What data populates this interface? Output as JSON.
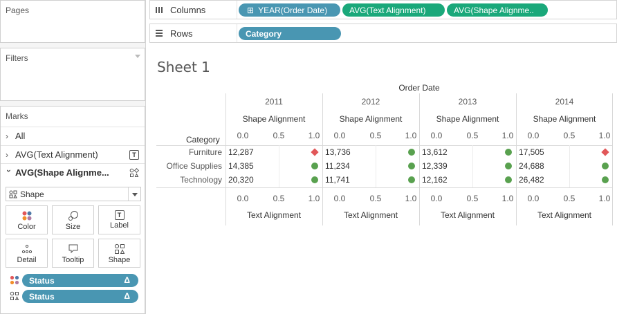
{
  "left_panel": {
    "pages_title": "Pages",
    "filters_title": "Filters",
    "marks_title": "Marks",
    "marks_rows": [
      {
        "label": "All",
        "expanded": false
      },
      {
        "label": "AVG(Text Alignment)",
        "expanded": false,
        "icon": "text-label-icon"
      },
      {
        "label": "AVG(Shape Alignme...",
        "expanded": true,
        "icon": "shape-icon"
      }
    ],
    "mark_type": "Shape",
    "mark_buttons": [
      {
        "label": "Color",
        "icon": "color-icon"
      },
      {
        "label": "Size",
        "icon": "size-icon"
      },
      {
        "label": "Label",
        "icon": "label-icon"
      },
      {
        "label": "Detail",
        "icon": "detail-icon"
      },
      {
        "label": "Tooltip",
        "icon": "tooltip-icon"
      },
      {
        "label": "Shape",
        "icon": "shape-icon"
      }
    ],
    "fields": [
      {
        "label": "Status",
        "encoding": "color"
      },
      {
        "label": "Status",
        "encoding": "shape"
      }
    ],
    "delta_symbol": "Δ"
  },
  "shelves": {
    "columns_label": "Columns",
    "rows_label": "Rows",
    "column_pills": [
      "YEAR(Order Date)",
      "AVG(Text Alignment)",
      "AVG(Shape Alignme.."
    ],
    "row_pills": [
      "Category"
    ],
    "plus_symbol": "⊞"
  },
  "sheet": {
    "title": "Sheet 1",
    "top_header": "Order Date",
    "row_header": "Category",
    "shape_axis_title": "Shape Alignment",
    "text_axis_title": "Text Alignment",
    "axis_ticks": [
      "0.0",
      "0.5",
      "1.0"
    ],
    "years": [
      "2011",
      "2012",
      "2013",
      "2014"
    ],
    "categories": [
      "Furniture",
      "Office Supplies",
      "Technology"
    ],
    "values": [
      [
        "12,287",
        "13,736",
        "13,612",
        "17,505"
      ],
      [
        "14,385",
        "11,234",
        "12,339",
        "24,688"
      ],
      [
        "20,320",
        "11,741",
        "12,162",
        "26,482"
      ]
    ],
    "shapes": [
      [
        "diamond",
        "circle",
        "circle",
        "diamond"
      ],
      [
        "circle",
        "circle",
        "circle",
        "circle"
      ],
      [
        "circle",
        "circle",
        "circle",
        "circle"
      ]
    ],
    "colors": {
      "circle": "#59a14f",
      "diamond": "#e15759"
    }
  }
}
